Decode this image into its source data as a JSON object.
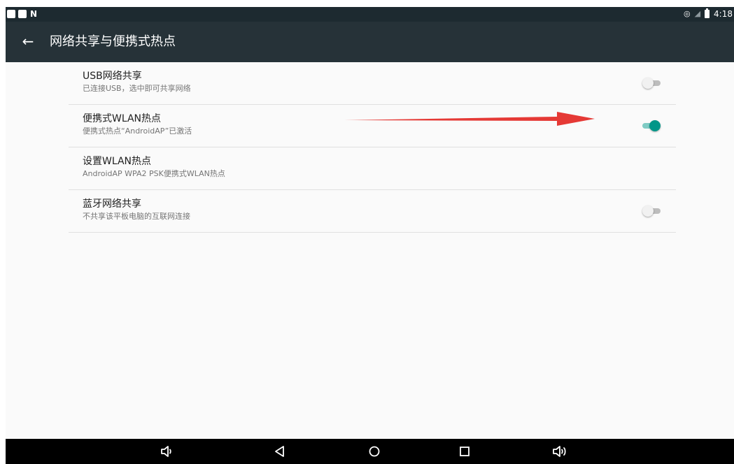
{
  "status_bar": {
    "time": "4:18",
    "left_icons": [
      "notification-square-icon",
      "notification-square-icon",
      "n-letter-icon"
    ],
    "right_icons": [
      "hotspot-icon",
      "no-signal-icon",
      "battery-icon"
    ]
  },
  "app_bar": {
    "back_icon": "arrow-back-icon",
    "title": "网络共享与便携式热点"
  },
  "settings": [
    {
      "title": "USB网络共享",
      "summary": "已连接USB，选中即可共享网络",
      "has_switch": true,
      "checked": false
    },
    {
      "title": "便携式WLAN热点",
      "summary": "便携式热点“AndroidAP”已激活",
      "has_switch": true,
      "checked": true
    },
    {
      "title": "设置WLAN热点",
      "summary": "AndroidAP WPA2 PSK便携式WLAN热点",
      "has_switch": false,
      "checked": false
    },
    {
      "title": "蓝牙网络共享",
      "summary": "不共享该平板电脑的互联网连接",
      "has_switch": true,
      "checked": false
    }
  ],
  "nav_bar": {
    "buttons": [
      "volume-down-icon",
      "back-triangle-icon",
      "home-circle-icon",
      "recents-square-icon",
      "volume-up-icon"
    ]
  },
  "colors": {
    "status_bar": "#1d2a30",
    "app_bar": "#263238",
    "accent": "#009688",
    "annotation_arrow": "#e53935"
  }
}
